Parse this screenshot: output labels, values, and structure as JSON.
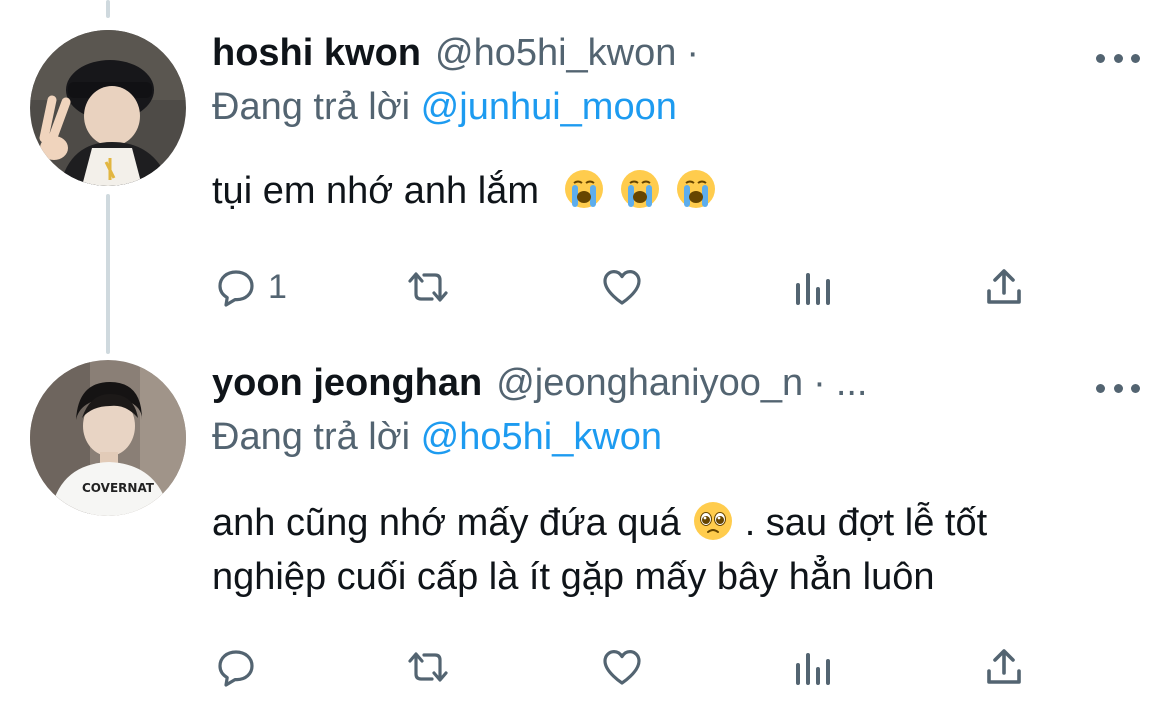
{
  "colors": {
    "text_primary": "#0f1419",
    "text_secondary": "#536471",
    "accent_link": "#1d9bf0",
    "thread_line": "#cfd9de"
  },
  "tweets": [
    {
      "avatar_icon": "user-avatar-photo",
      "display_name": "hoshi kwon",
      "handle": "@ho5hi_kwon",
      "separator": "·",
      "handle_overflow": "",
      "replying_prefix": "Đang trả lời",
      "replying_to": "@junhui_moon",
      "text": "tụi em nhớ anh lắm",
      "emojis": [
        "loudly-crying-face",
        "loudly-crying-face",
        "loudly-crying-face"
      ],
      "actions": {
        "reply_count": "1",
        "retweet_count": "",
        "like_count": ""
      }
    },
    {
      "avatar_icon": "user-avatar-photo",
      "display_name": "yoon jeonghan",
      "handle": "@jeonghaniyoo_n",
      "separator": "·",
      "handle_overflow": "...",
      "replying_prefix": "Đang trả lời",
      "replying_to": "@ho5hi_kwon",
      "text_part1": "anh cũng nhớ mấy đứa quá",
      "emojis": [
        "pleading-face"
      ],
      "text_part2": ". sau đợt lễ tốt nghiệp cuối cấp là ít gặp mấy bây hẳn luôn",
      "actions": {
        "reply_count": "",
        "retweet_count": "",
        "like_count": ""
      }
    }
  ]
}
